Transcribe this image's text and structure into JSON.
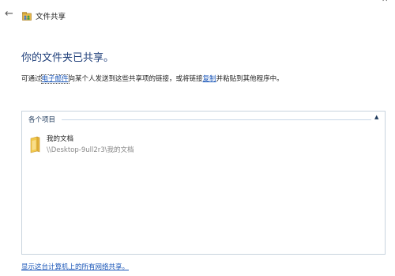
{
  "window": {
    "title": "文件共享",
    "minimize_glyph": "—",
    "close_glyph": "✕"
  },
  "nav": {
    "back_icon": "back-arrow-icon",
    "back_glyph": "←"
  },
  "main": {
    "heading": "你的文件夹已共享。",
    "desc": {
      "part1": "可通过",
      "link1": "电子邮件",
      "part2": "向某个人发送到这些共享项的链接，或将链接",
      "link2": "复制",
      "part3": "并粘贴到其他程序中。"
    },
    "group": {
      "header": "各个项目",
      "collapse_glyph": "▲",
      "items": [
        {
          "name": "我的文档",
          "path": "\\\\Desktop-9ull2r3\\我的文档",
          "icon": "folder-icon"
        }
      ]
    },
    "footer_link": "显示这台计算机上的所有网络共享。"
  },
  "colors": {
    "heading": "#1f3f7a",
    "link": "#1a56b8",
    "panel_border": "#c8d3de",
    "folder": "#f2c94c"
  }
}
